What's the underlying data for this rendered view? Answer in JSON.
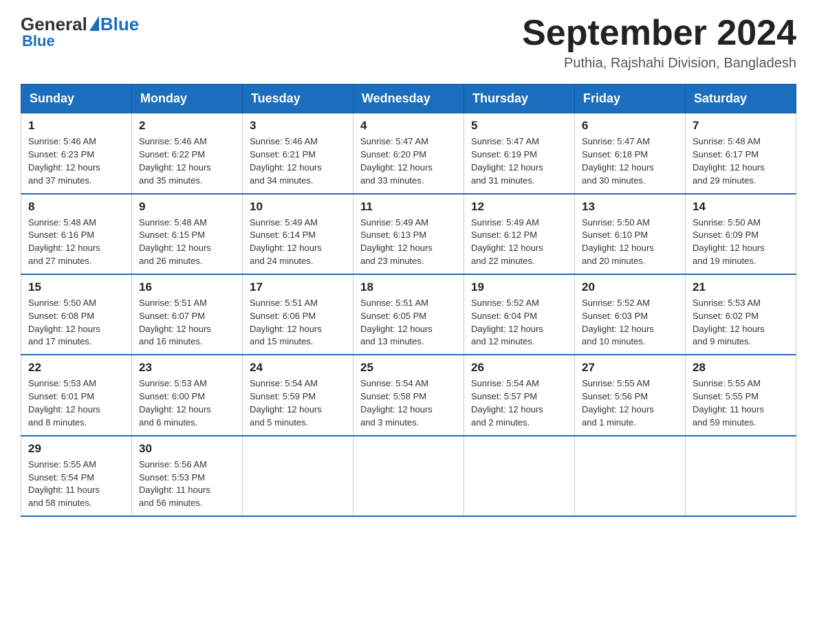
{
  "header": {
    "logo": {
      "general": "General",
      "blue": "Blue"
    },
    "title": "September 2024",
    "location": "Puthia, Rajshahi Division, Bangladesh"
  },
  "weekdays": [
    "Sunday",
    "Monday",
    "Tuesday",
    "Wednesday",
    "Thursday",
    "Friday",
    "Saturday"
  ],
  "weeks": [
    [
      {
        "day": "1",
        "sunrise": "5:46 AM",
        "sunset": "6:23 PM",
        "daylight": "12 hours and 37 minutes."
      },
      {
        "day": "2",
        "sunrise": "5:46 AM",
        "sunset": "6:22 PM",
        "daylight": "12 hours and 35 minutes."
      },
      {
        "day": "3",
        "sunrise": "5:46 AM",
        "sunset": "6:21 PM",
        "daylight": "12 hours and 34 minutes."
      },
      {
        "day": "4",
        "sunrise": "5:47 AM",
        "sunset": "6:20 PM",
        "daylight": "12 hours and 33 minutes."
      },
      {
        "day": "5",
        "sunrise": "5:47 AM",
        "sunset": "6:19 PM",
        "daylight": "12 hours and 31 minutes."
      },
      {
        "day": "6",
        "sunrise": "5:47 AM",
        "sunset": "6:18 PM",
        "daylight": "12 hours and 30 minutes."
      },
      {
        "day": "7",
        "sunrise": "5:48 AM",
        "sunset": "6:17 PM",
        "daylight": "12 hours and 29 minutes."
      }
    ],
    [
      {
        "day": "8",
        "sunrise": "5:48 AM",
        "sunset": "6:16 PM",
        "daylight": "12 hours and 27 minutes."
      },
      {
        "day": "9",
        "sunrise": "5:48 AM",
        "sunset": "6:15 PM",
        "daylight": "12 hours and 26 minutes."
      },
      {
        "day": "10",
        "sunrise": "5:49 AM",
        "sunset": "6:14 PM",
        "daylight": "12 hours and 24 minutes."
      },
      {
        "day": "11",
        "sunrise": "5:49 AM",
        "sunset": "6:13 PM",
        "daylight": "12 hours and 23 minutes."
      },
      {
        "day": "12",
        "sunrise": "5:49 AM",
        "sunset": "6:12 PM",
        "daylight": "12 hours and 22 minutes."
      },
      {
        "day": "13",
        "sunrise": "5:50 AM",
        "sunset": "6:10 PM",
        "daylight": "12 hours and 20 minutes."
      },
      {
        "day": "14",
        "sunrise": "5:50 AM",
        "sunset": "6:09 PM",
        "daylight": "12 hours and 19 minutes."
      }
    ],
    [
      {
        "day": "15",
        "sunrise": "5:50 AM",
        "sunset": "6:08 PM",
        "daylight": "12 hours and 17 minutes."
      },
      {
        "day": "16",
        "sunrise": "5:51 AM",
        "sunset": "6:07 PM",
        "daylight": "12 hours and 16 minutes."
      },
      {
        "day": "17",
        "sunrise": "5:51 AM",
        "sunset": "6:06 PM",
        "daylight": "12 hours and 15 minutes."
      },
      {
        "day": "18",
        "sunrise": "5:51 AM",
        "sunset": "6:05 PM",
        "daylight": "12 hours and 13 minutes."
      },
      {
        "day": "19",
        "sunrise": "5:52 AM",
        "sunset": "6:04 PM",
        "daylight": "12 hours and 12 minutes."
      },
      {
        "day": "20",
        "sunrise": "5:52 AM",
        "sunset": "6:03 PM",
        "daylight": "12 hours and 10 minutes."
      },
      {
        "day": "21",
        "sunrise": "5:53 AM",
        "sunset": "6:02 PM",
        "daylight": "12 hours and 9 minutes."
      }
    ],
    [
      {
        "day": "22",
        "sunrise": "5:53 AM",
        "sunset": "6:01 PM",
        "daylight": "12 hours and 8 minutes."
      },
      {
        "day": "23",
        "sunrise": "5:53 AM",
        "sunset": "6:00 PM",
        "daylight": "12 hours and 6 minutes."
      },
      {
        "day": "24",
        "sunrise": "5:54 AM",
        "sunset": "5:59 PM",
        "daylight": "12 hours and 5 minutes."
      },
      {
        "day": "25",
        "sunrise": "5:54 AM",
        "sunset": "5:58 PM",
        "daylight": "12 hours and 3 minutes."
      },
      {
        "day": "26",
        "sunrise": "5:54 AM",
        "sunset": "5:57 PM",
        "daylight": "12 hours and 2 minutes."
      },
      {
        "day": "27",
        "sunrise": "5:55 AM",
        "sunset": "5:56 PM",
        "daylight": "12 hours and 1 minute."
      },
      {
        "day": "28",
        "sunrise": "5:55 AM",
        "sunset": "5:55 PM",
        "daylight": "11 hours and 59 minutes."
      }
    ],
    [
      {
        "day": "29",
        "sunrise": "5:55 AM",
        "sunset": "5:54 PM",
        "daylight": "11 hours and 58 minutes."
      },
      {
        "day": "30",
        "sunrise": "5:56 AM",
        "sunset": "5:53 PM",
        "daylight": "11 hours and 56 minutes."
      },
      null,
      null,
      null,
      null,
      null
    ]
  ],
  "labels": {
    "sunrise": "Sunrise:",
    "sunset": "Sunset:",
    "daylight": "Daylight:"
  }
}
